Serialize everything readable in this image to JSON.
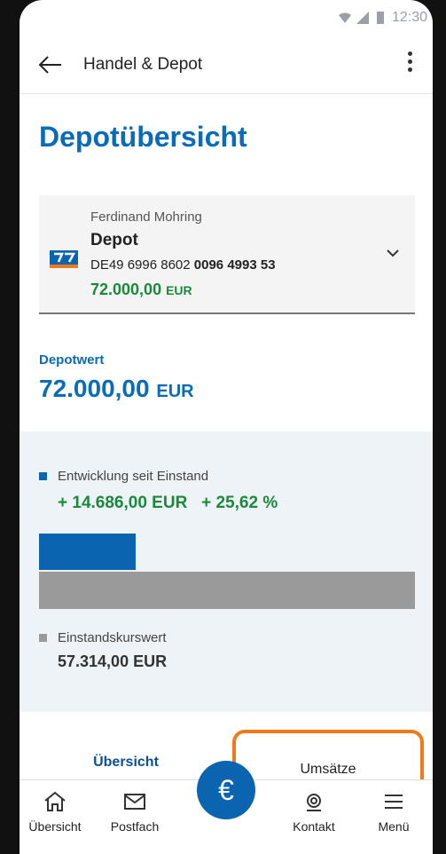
{
  "status_bar": {
    "time": "12:30"
  },
  "app_bar": {
    "title": "Handel & Depot"
  },
  "page": {
    "title": "Depotübersicht"
  },
  "account": {
    "owner": "Ferdinand Mohring",
    "name": "Depot",
    "iban_prefix": "DE49 6996 8602",
    "iban_suffix": "0096 4993 53",
    "balance": "72.000,00",
    "currency": "EUR"
  },
  "depot_value": {
    "label": "Depotwert",
    "amount": "72.000,00",
    "currency": "EUR"
  },
  "development": {
    "label": "Entwicklung seit Einstand",
    "amount": "+ 14.686,00 EUR",
    "percent": "+ 25,62 %",
    "fraction_of_base": 0.2562,
    "color": "#0a64b0"
  },
  "base_value": {
    "label": "Einstandskurswert",
    "amount": "57.314,00 EUR",
    "color": "#9a9a9a"
  },
  "tabs": {
    "overview": "Übersicht",
    "transactions": "Umsätze"
  },
  "bottom_nav": {
    "items": [
      {
        "label": "Übersicht",
        "icon": "home-icon"
      },
      {
        "label": "Postfach",
        "icon": "mail-icon"
      },
      {
        "label": "",
        "icon": "euro-icon"
      },
      {
        "label": "Kontakt",
        "icon": "headset-icon"
      },
      {
        "label": "Menü",
        "icon": "menu-icon"
      }
    ],
    "fab_symbol": "€"
  },
  "colors": {
    "primary": "#0a6bb8",
    "positive": "#1a8a3a",
    "highlight": "#f07a1a"
  }
}
